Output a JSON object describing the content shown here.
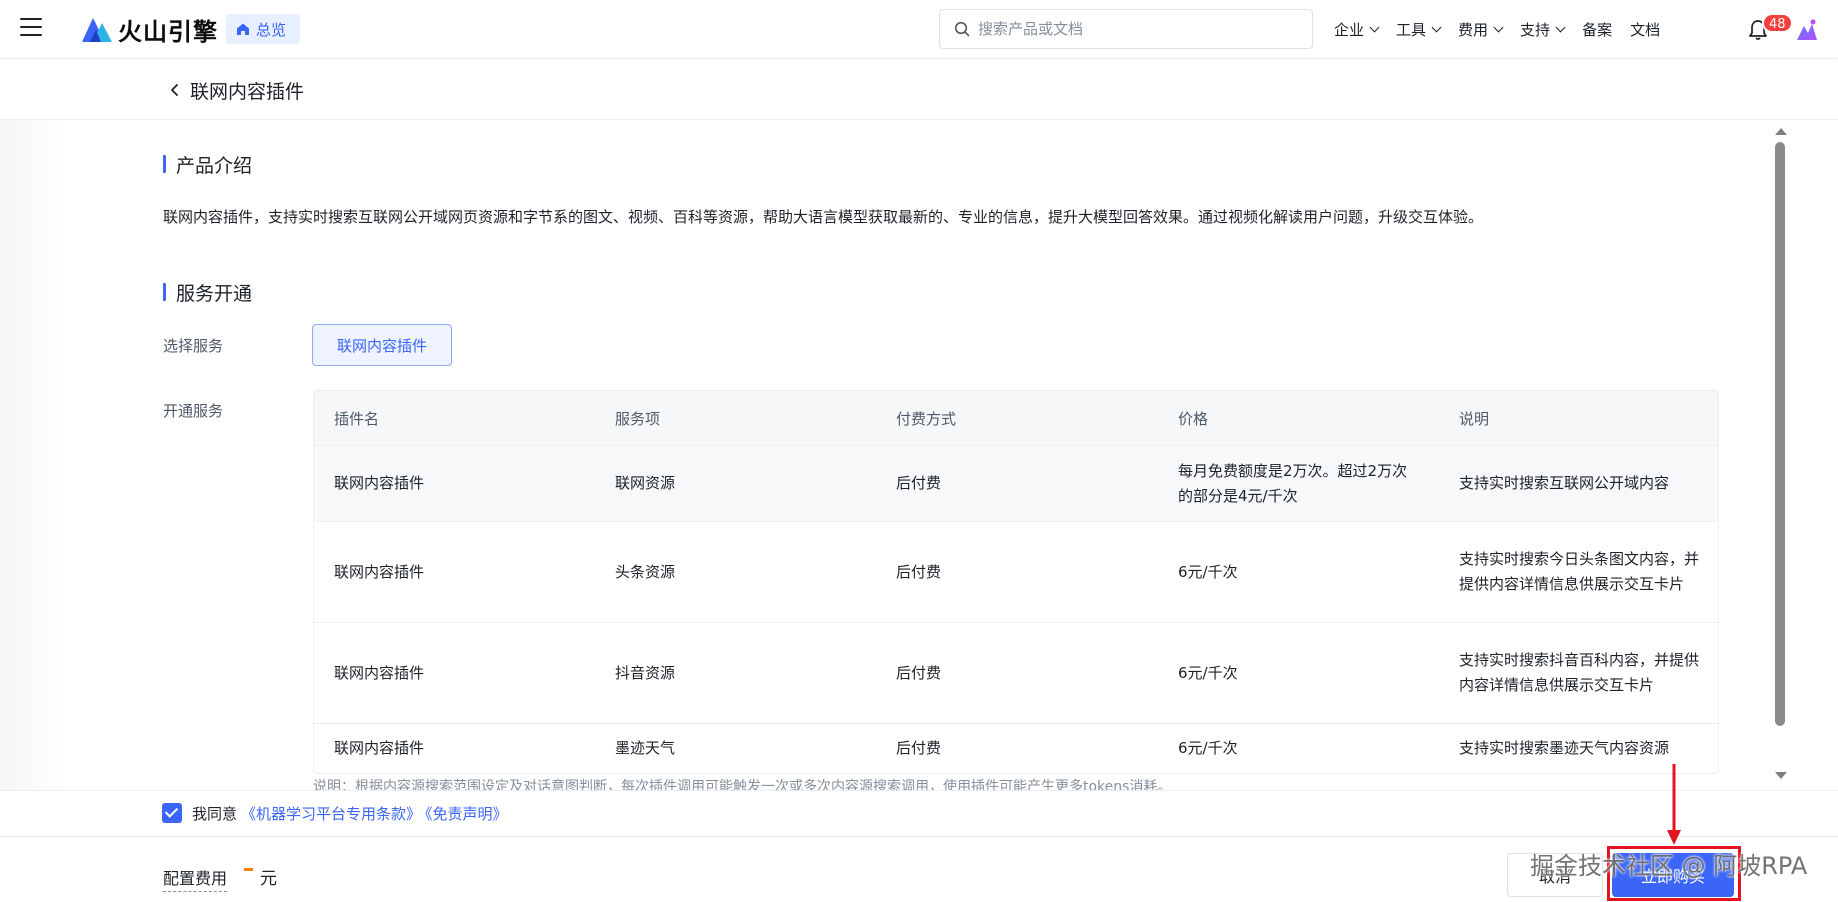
{
  "brand": {
    "name": "火山引擎",
    "accent": "#3a65f6"
  },
  "header": {
    "home_tag": "总览",
    "search_placeholder": "搜索产品或文档",
    "nav": [
      {
        "label": "企业",
        "dropdown": true
      },
      {
        "label": "工具",
        "dropdown": true
      },
      {
        "label": "费用",
        "dropdown": true
      },
      {
        "label": "支持",
        "dropdown": true
      },
      {
        "label": "备案",
        "dropdown": false
      },
      {
        "label": "文档",
        "dropdown": false
      }
    ],
    "notification_count": "48"
  },
  "page": {
    "title": "联网内容插件"
  },
  "intro": {
    "title": "产品介绍",
    "text": "联网内容插件，支持实时搜索互联网公开域网页资源和字节系的图文、视频、百科等资源，帮助大语言模型获取最新的、专业的信息，提升大模型回答效果。通过视频化解读用户问题，升级交互体验。"
  },
  "service": {
    "title": "服务开通",
    "select_label": "选择服务",
    "selected_option": "联网内容插件",
    "open_label": "开通服务",
    "table": {
      "headers": [
        "插件名",
        "服务项",
        "付费方式",
        "价格",
        "说明"
      ],
      "rows": [
        [
          "联网内容插件",
          "联网资源",
          "后付费",
          "每月免费额度是2万次。超过2万次的部分是4元/千次",
          "支持实时搜索互联网公开域内容"
        ],
        [
          "联网内容插件",
          "头条资源",
          "后付费",
          "6元/千次",
          "支持实时搜索今日头条图文内容，并提供内容详情信息供展示交互卡片"
        ],
        [
          "联网内容插件",
          "抖音资源",
          "后付费",
          "6元/千次",
          "支持实时搜索抖音百科内容，并提供内容详情信息供展示交互卡片"
        ],
        [
          "联网内容插件",
          "墨迹天气",
          "后付费",
          "6元/千次",
          "支持实时搜索墨迹天气内容资源"
        ]
      ]
    },
    "note": "说明：根据内容源搜索范围设定及对话意图判断，每次插件调用可能触发一次或多次内容源搜索调用，使用插件可能产生更多tokens消耗。"
  },
  "agreement": {
    "checked": true,
    "prefix": "我同意",
    "link1": "《机器学习平台专用条款》",
    "link2": "《免责声明》"
  },
  "footer": {
    "cost_label": "配置费用",
    "cost_unit": "元",
    "cancel_label": "取消",
    "buy_label": "立即购买"
  },
  "watermark": "掘金技术社区 @ 阿坡RPA"
}
